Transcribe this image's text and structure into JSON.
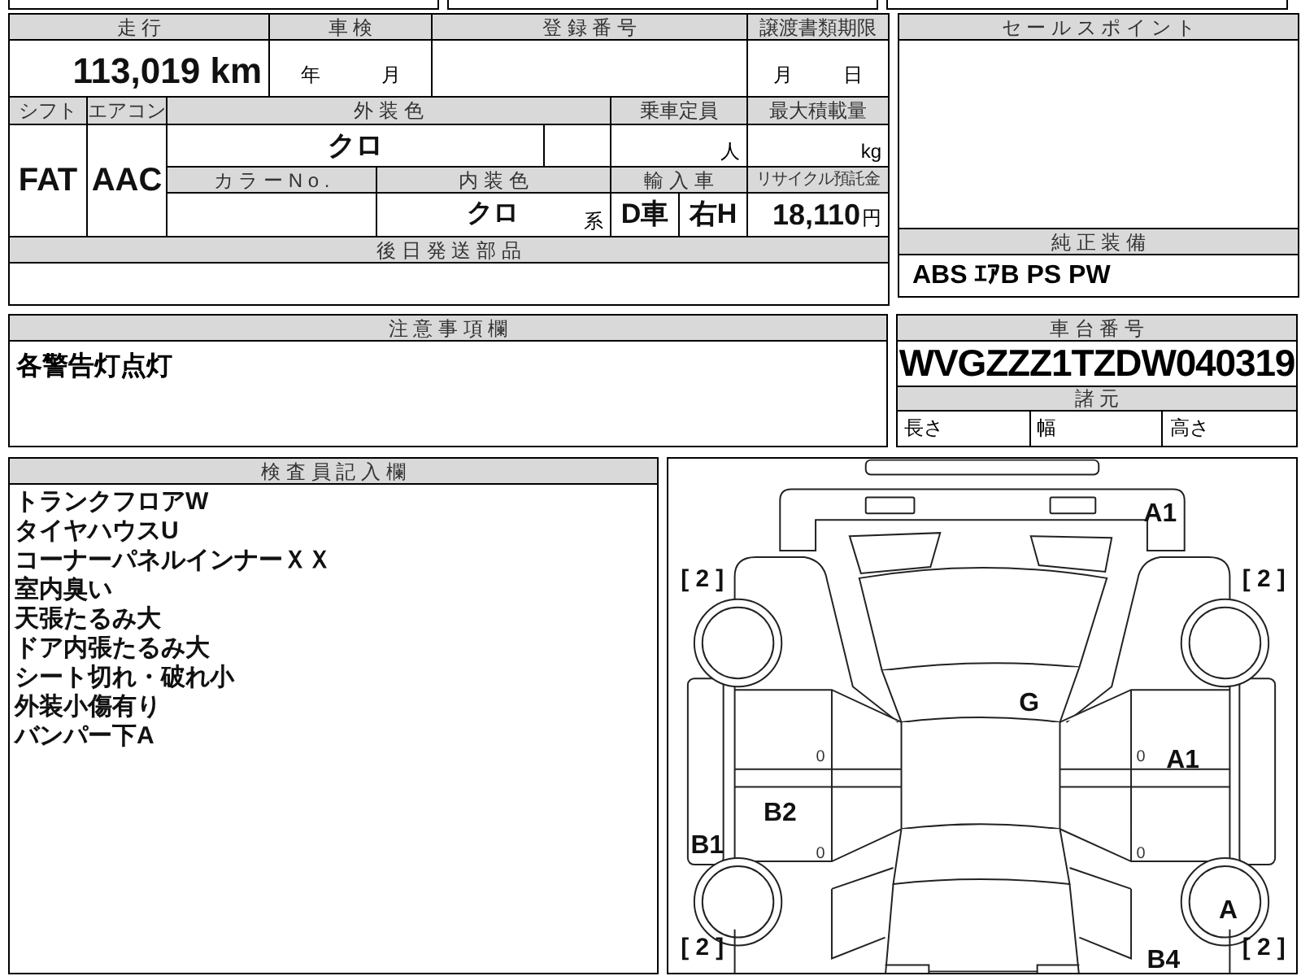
{
  "sheet": {
    "mileage": {
      "label": "走 行",
      "value": "113,019",
      "unit": "km"
    },
    "inspection": {
      "label": "車 検",
      "year": "年",
      "month": "月"
    },
    "registration": {
      "label": "登 録 番 号"
    },
    "transfer_deadline": {
      "label": "譲渡書類期限",
      "month": "月",
      "day": "日"
    },
    "shift": {
      "label": "シフト",
      "value": "FAT"
    },
    "aircon": {
      "label": "エアコン",
      "value": "AAC"
    },
    "exterior_color": {
      "label": "外 装 色",
      "value": "クロ"
    },
    "capacity": {
      "label": "乗車定員",
      "unit": "人"
    },
    "max_load": {
      "label": "最大積載量",
      "unit": "kg"
    },
    "color_no": {
      "label": "カ ラ ー N o ."
    },
    "interior_color": {
      "label": "内 装 色",
      "value": "クロ",
      "suffix": "系"
    },
    "import": {
      "label": "輸 入 車",
      "values": [
        "D車",
        "右H"
      ]
    },
    "recycle": {
      "label": "リサイクル預託金",
      "value": "18,110",
      "unit": "円"
    },
    "later_parts": {
      "label": "後 日 発 送 部 品"
    }
  },
  "sales_points": {
    "label": "セ ー ル ス ポ イ ン ト"
  },
  "equipment": {
    "label": "純 正 装 備",
    "value": "ABS ｴｱB PS PW"
  },
  "notes": {
    "label": "注 意 事 項 欄",
    "value": "各警告灯点灯"
  },
  "chassis": {
    "label": "車 台 番 号",
    "value": "WVGZZZ1TZDW040319"
  },
  "specs": {
    "label": "諸 元",
    "fields": [
      "長さ",
      "幅",
      "高さ"
    ]
  },
  "inspector": {
    "label": "検 査 員 記 入 欄",
    "lines": [
      "トランクフロアW",
      "タイヤハウスU",
      "コーナーパネルインナーＸＸ",
      "室内臭い",
      "天張たるみ大",
      "ドア内張たるみ大",
      "シート切れ・破れ小",
      "外装小傷有り",
      "バンパー下A"
    ]
  },
  "diagram": {
    "marks": [
      "A1",
      "G",
      "A1",
      "B2",
      "B1",
      "A",
      "B4"
    ],
    "tires": [
      "[ 2 ]",
      "[ 2 ]",
      "[ 2 ]",
      "[ 2 ]"
    ],
    "zeros": [
      "0",
      "0",
      "0",
      "0"
    ]
  }
}
